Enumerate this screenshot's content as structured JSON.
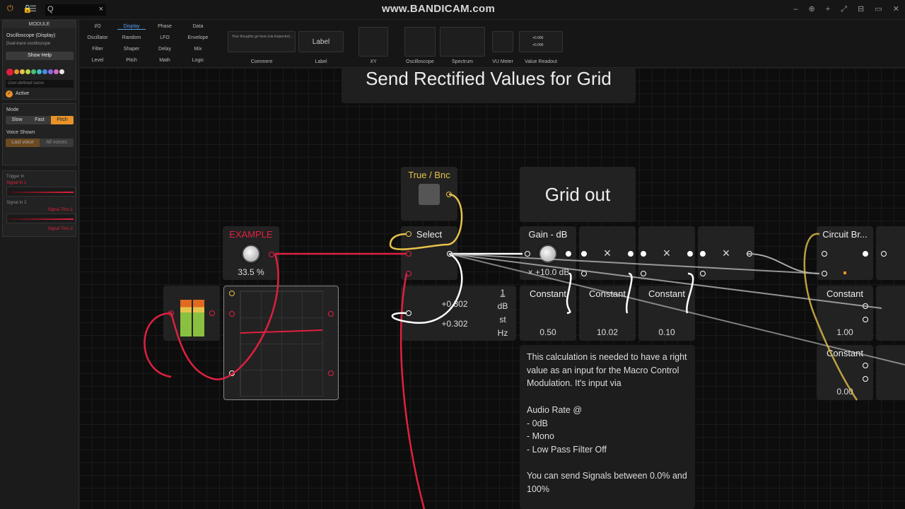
{
  "topbar": {
    "watermark": "www.BANDICAM.com",
    "search_icon": "Q",
    "close": "×",
    "window_controls": "‒ ⊕ + ⤢ ⊟ ▭ ✕"
  },
  "sidebar": {
    "module_title": "MODULE",
    "module_name": "Oscilloscope (Display)",
    "module_desc": "Dual-trace oscilloscope",
    "show_help": "Show Help",
    "colors": [
      "#e02040",
      "#e8932a",
      "#e6c24a",
      "#b8d84a",
      "#4ac07a",
      "#3ac0c0",
      "#4a8ae6",
      "#8a6ae6",
      "#d86ac0",
      "#e8e8e8"
    ],
    "custom_name_placeholder": "User-defined name",
    "active_label": "Active",
    "mode_label": "Mode",
    "mode_options": [
      "Slow",
      "Fast",
      "Pitch"
    ],
    "voice_label": "Voice Shown",
    "voice_options": [
      "Last voice",
      "All voices"
    ],
    "trigger_in": "Trigger In",
    "signal_in_1": "Signal In 1",
    "signal_in_2": "Signal In 2",
    "signal_thru_1": "Signal Thru 1",
    "signal_thru_2": "Signal Thru 2"
  },
  "toolbar": {
    "categories": [
      [
        "I/O",
        "Display",
        "Phase",
        "Data"
      ],
      [
        "Oscillator",
        "LFO",
        "Envelope"
      ],
      [
        "Filter",
        "Shaper",
        "Delay",
        "Mix"
      ],
      [
        "Level",
        "Pitch",
        "Math",
        "Logic"
      ]
    ],
    "cat_col1": [
      "I/O",
      "Oscillator",
      "Filter",
      "Level"
    ],
    "cat_col2": [
      "Display",
      "Random",
      "Shaper",
      "Pitch"
    ],
    "cat_col3": [
      "Phase",
      "LFO",
      "Delay",
      "Math"
    ],
    "cat_col4": [
      "Data",
      "Envelope",
      "Mix",
      "Logic"
    ],
    "comment_placeholder": "Your thoughts go here (via Inspector)...",
    "tools": [
      "Comment",
      "Label",
      "XY",
      "Oscilloscope",
      "Spectrum",
      "VU Meter",
      "Value Readout"
    ],
    "label_button": "Label",
    "readout_vals": [
      "+0.000",
      "+0.000"
    ],
    "readout_units": [
      "1",
      "dB",
      "st",
      "Hz"
    ]
  },
  "canvas": {
    "header_title": "Send  Rectified Values for Grid",
    "true_bnc_title": "True / Bnc",
    "grid_out_title": "Grid out",
    "example_title": "EXAMPLE",
    "example_value": "33.5 %",
    "select_title": "Select",
    "readout_val1": "+0.302",
    "readout_val2": "+0.302",
    "readout_units": [
      "1",
      "dB",
      "st",
      "Hz"
    ],
    "gain_title": "Gain - dB",
    "gain_value": "+10.0 dB",
    "multiply_symbol": "×",
    "constants": [
      {
        "label": "Constant",
        "value": "0.50"
      },
      {
        "label": "Constant",
        "value": "10.02"
      },
      {
        "label": "Constant",
        "value": "0.10"
      },
      {
        "label": "Constant",
        "value": "1.00"
      },
      {
        "label": "Constant",
        "value": "0.00"
      }
    ],
    "circuit_title": "Circuit Br...",
    "comment_lines": [
      "This  calculation is needed to have a right value as an input for the Macro Control Modulation. It's input via",
      "",
      "Audio Rate @",
      "- 0dB",
      "- Mono",
      "- Low Pass Filter Off",
      "",
      "You can send Signals between 0.0% and 100%"
    ]
  },
  "colors": {
    "accent": "#e8932a",
    "wire_red": "#e02040",
    "wire_yellow": "#e6c24a",
    "wire_white": "#ffffff",
    "selected_cat": "#5aa0f0"
  }
}
